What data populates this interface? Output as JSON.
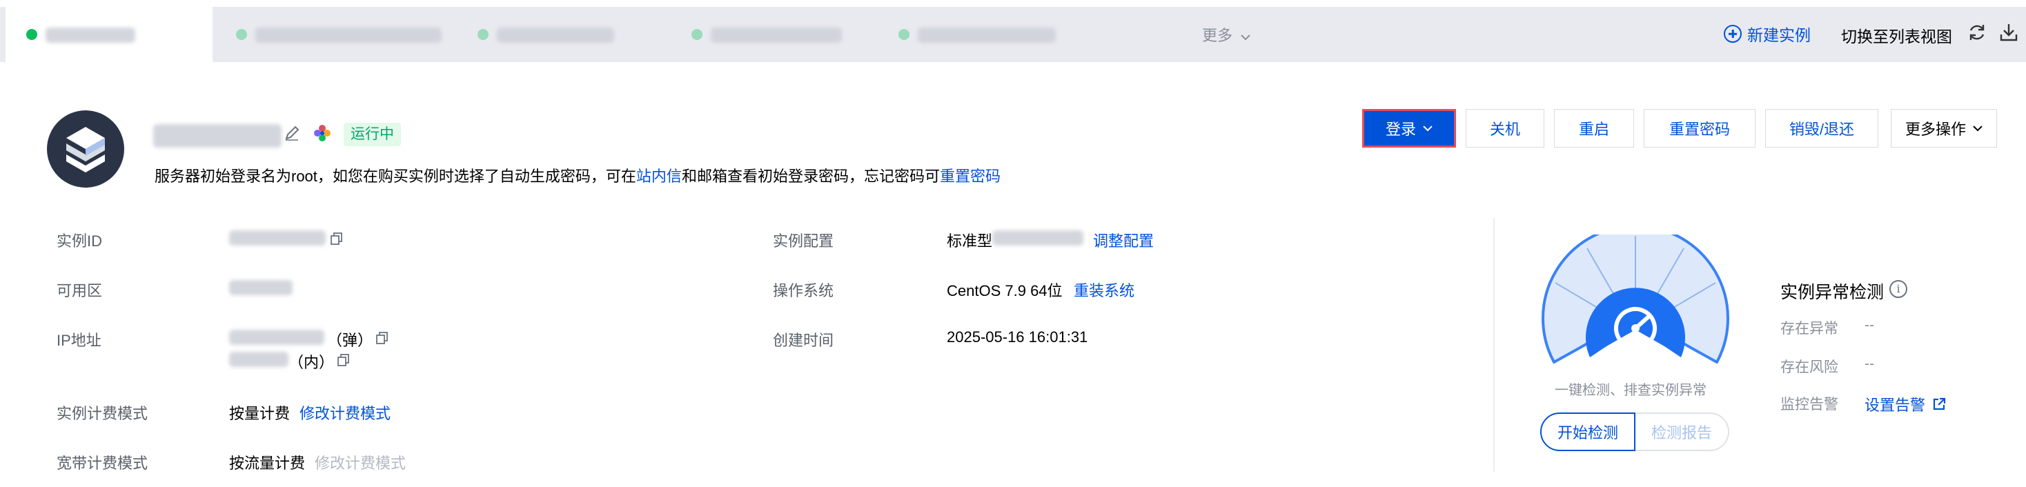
{
  "tabbar": {
    "more_label": "更多",
    "new_instance_label": "新建实例",
    "switch_view_label": "切换至列表视图"
  },
  "instance": {
    "status": "运行中",
    "tip_prefix": "服务器初始登录名为root，如您在购买实例时选择了自动生成密码，可在",
    "tip_link1": "站内信",
    "tip_middle": "和邮箱查看初始登录密码，忘记密码可",
    "tip_link2": "重置密码"
  },
  "actions": {
    "login": "登录",
    "shutdown": "关机",
    "restart": "重启",
    "reset_password": "重置密码",
    "destroy": "销毁/退还",
    "more": "更多操作"
  },
  "info": {
    "instance_id_label": "实例ID",
    "zone_label": "可用区",
    "ip_label": "IP地址",
    "ip_public_suffix": "（弹）",
    "ip_private_suffix": "（内）",
    "billing_label": "实例计费模式",
    "billing_value": "按量计费",
    "billing_link": "修改计费模式",
    "bandwidth_label": "宽带计费模式",
    "bandwidth_value": "按流量计费",
    "bandwidth_link": "修改计费模式",
    "config_label": "实例配置",
    "config_value": "标准型",
    "config_link": "调整配置",
    "os_label": "操作系统",
    "os_value": "CentOS 7.9 64位",
    "os_link": "重装系统",
    "created_label": "创建时间",
    "created_value": "2025-05-16 16:01:31"
  },
  "detection": {
    "gauge_caption": "一键检测、排查实例异常",
    "start_button": "开始检测",
    "report_button": "检测报告",
    "title": "实例异常检测",
    "exist_error_label": "存在异常",
    "exist_error_value": "--",
    "exist_risk_label": "存在风险",
    "exist_risk_value": "--",
    "monitor_label": "监控告警",
    "monitor_link": "设置告警"
  },
  "colors": {
    "primary": "#0052d9",
    "running_green": "#00a870",
    "login_border": "#e34d59"
  }
}
